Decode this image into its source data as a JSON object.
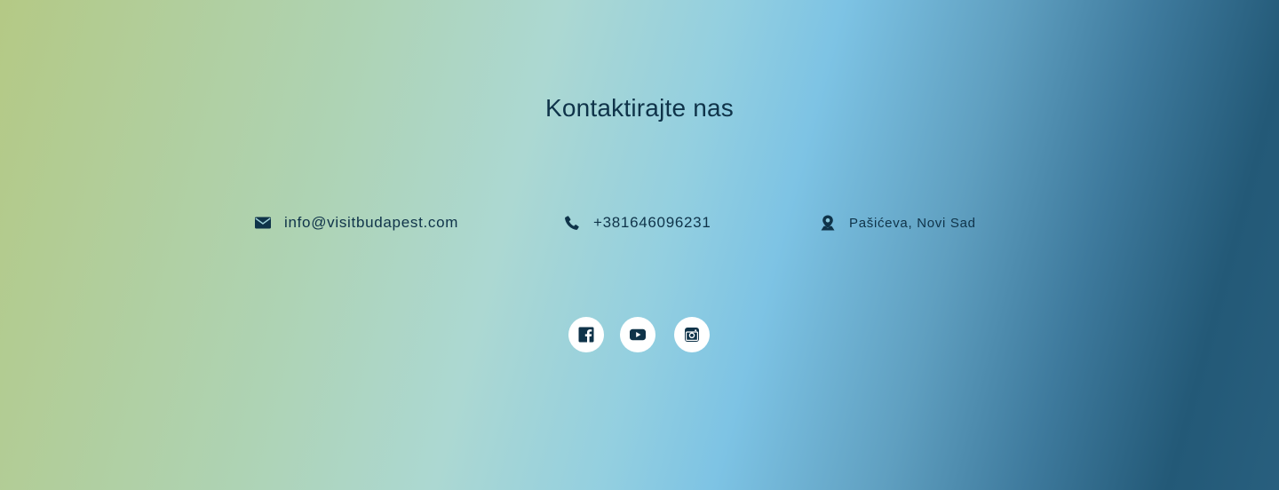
{
  "contact": {
    "title": "Kontaktirajte nas",
    "email": {
      "icon": "envelope-icon",
      "label": "info@visitbudapest.com"
    },
    "phone": {
      "icon": "phone-icon",
      "label": "+381646096231"
    },
    "address": {
      "icon": "map-marker-icon",
      "label": "Pašićeva, Novi Sad"
    }
  },
  "social": [
    {
      "icon": "facebook-icon"
    },
    {
      "icon": "youtube-icon"
    },
    {
      "icon": "instagram-icon"
    }
  ],
  "colors": {
    "text": "#0f3349",
    "icon_bg": "#ffffff",
    "gradient_start": "#b4c985",
    "gradient_mid": "#7dc3e4",
    "gradient_end": "#235977"
  }
}
